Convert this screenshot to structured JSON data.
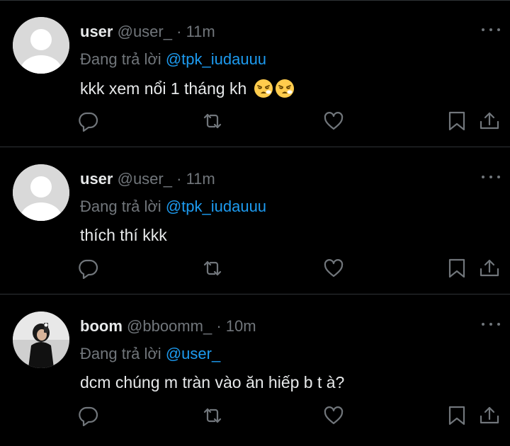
{
  "tweets": [
    {
      "name": "user",
      "handle": "@user_",
      "separator": "·",
      "time": "11m",
      "reply_prefix": "Đang trả lời",
      "reply_to": "@tpk_iudauuu",
      "text": "kkk xem nổi 1 tháng kh",
      "emojis": [
        "tired-face-emoji",
        "tired-face-emoji"
      ]
    },
    {
      "name": "user",
      "handle": "@user_",
      "separator": "·",
      "time": "11m",
      "reply_prefix": "Đang trả lời",
      "reply_to": "@tpk_iudauuu",
      "text": "thích thí kkk"
    },
    {
      "name": "boom",
      "handle": "@bboomm_",
      "separator": "·",
      "time": "10m",
      "reply_prefix": "Đang trả lời",
      "reply_to": "@user_",
      "text": "dcm chúng m tràn vào ăn hiếp b t à?"
    }
  ],
  "icons": [
    "more-icon",
    "reply-icon",
    "retweet-icon",
    "like-icon",
    "bookmark-icon",
    "share-icon"
  ],
  "colors": {
    "background": "#000000",
    "text_primary": "#e7e9ea",
    "text_secondary": "#71767b",
    "link": "#1d9bf0",
    "divider": "#2f3336"
  }
}
